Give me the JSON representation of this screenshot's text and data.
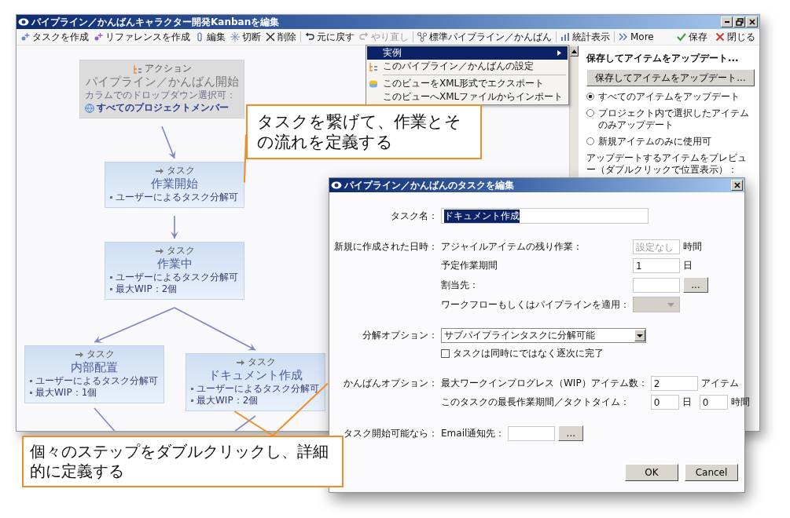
{
  "window": {
    "title": "パイプライン／かんばんキャラクター開発Kanbanを編集"
  },
  "toolbar": {
    "groups": [
      [
        {
          "label": "タスクを作成",
          "disabled": false
        },
        {
          "label": "リファレンスを作成",
          "disabled": false
        },
        {
          "label": "編集",
          "disabled": false
        },
        {
          "label": "切断",
          "disabled": false
        },
        {
          "label": "削除",
          "disabled": false
        }
      ],
      [
        {
          "label": "元に戻す",
          "disabled": false
        },
        {
          "label": "やり直し",
          "disabled": true
        }
      ],
      [
        {
          "label": "標準パイプライン／かんばん",
          "disabled": false
        }
      ],
      [
        {
          "label": "統計表示",
          "disabled": false
        }
      ],
      [
        {
          "label": "More",
          "disabled": false
        }
      ]
    ],
    "actions": [
      {
        "label": "保存"
      },
      {
        "label": "閉じる"
      }
    ]
  },
  "menu": {
    "groups": [
      [
        {
          "label": "実例",
          "selected": true,
          "submenu": true
        },
        {
          "label": "このパイプライン／かんばんの設定",
          "selected": false,
          "submenu": false
        }
      ],
      [
        {
          "label": "このビューをXML形式でエクスポート",
          "selected": false,
          "submenu": false
        },
        {
          "label": "このビューへXMLファイルからインポート",
          "selected": false,
          "submenu": false
        }
      ]
    ]
  },
  "canvas": {
    "nodes": [
      {
        "kind": "action",
        "type_label": "アクション",
        "title": "パイプライン／かんばん開始",
        "note": "カラムでのドロップダウン選択可：",
        "member": "すべてのプロジェクトメンバー",
        "continues_below": false
      },
      {
        "kind": "task",
        "type_label": "タスク",
        "title": "作業開始",
        "bullets": [
          "ユーザーによるタスク分解可"
        ],
        "continues_below": false
      },
      {
        "kind": "task",
        "type_label": "タスク",
        "title": "作業中",
        "bullets": [
          "ユーザーによるタスク分解可",
          "最大WIP：2個"
        ],
        "continues_below": false
      },
      {
        "kind": "task",
        "type_label": "タスク",
        "title": "内部配置",
        "bullets": [
          "ユーザーによるタスク分解可",
          "最大WIP：1個"
        ],
        "continues_below": true
      },
      {
        "kind": "task",
        "type_label": "タスク",
        "title": "ドキュメント作成",
        "bullets": [
          "ユーザーによるタスク分解可",
          "最大WIP：2個"
        ],
        "continues_below": true
      }
    ]
  },
  "side_panel": {
    "heading": "保存してアイテムをアップデート...",
    "button": "保存してアイテムをアップデート...",
    "radios": [
      {
        "label": "すべてのアイテムをアップデート",
        "selected": true
      },
      {
        "label": "プロジェクト内で選択したアイテムのみアップデート",
        "selected": false
      },
      {
        "label": "新規アイテムのみに使用可",
        "selected": false
      }
    ],
    "preview_label": "アップデートするアイテムをプレビュー（ダブルクリックで位置表示）："
  },
  "dialog": {
    "title": "パイプライン／かんばんのタスクを編集",
    "groups": [
      {
        "label": "タスク名：",
        "rows": [
          {
            "kind": "name",
            "value": "ドキュメント作成",
            "value_selected": true
          }
        ]
      },
      {
        "label": "新規に作成された日時：",
        "rows": [
          {
            "kind": "field",
            "label": "アジャイルアイテムの残り作業：",
            "placeholder": "設定なし",
            "unit": "時間"
          },
          {
            "kind": "field",
            "label": "予定作業期間",
            "value": "1",
            "unit": "日"
          },
          {
            "kind": "picker",
            "label": "割当先：",
            "button": "..."
          },
          {
            "kind": "combo",
            "label": "ワークフローもしくはパイプラインを適用：",
            "disabled": true
          }
        ]
      },
      {
        "label": "分解オプション：",
        "rows": [
          {
            "kind": "select",
            "value": "サブパイプラインタスクに分解可能"
          },
          {
            "kind": "checkbox",
            "label": "タスクは同時にではなく逐次に完了",
            "checked": false
          }
        ]
      },
      {
        "label": "かんばんオプション：",
        "rows": [
          {
            "kind": "field",
            "label": "最大ワークインプログレス（WIP）アイテム数：",
            "value": "2",
            "unit": "アイテム"
          },
          {
            "kind": "duration",
            "label": "このタスクの最長作業期間／タクトタイム：",
            "fields": [
              {
                "value": "0",
                "unit": "日"
              },
              {
                "value": "0",
                "unit": "時間"
              }
            ]
          }
        ]
      },
      {
        "label": "タスク開始可能なら：",
        "rows": [
          {
            "kind": "picker",
            "label": "Email通知先：",
            "button": "..."
          }
        ]
      }
    ],
    "buttons": [
      {
        "label": "OK"
      },
      {
        "label": "Cancel"
      }
    ]
  },
  "callouts": [
    {
      "text": "タスクを繋げて、作業とその流れを定義する"
    },
    {
      "text": "個々のステップをダブルクリックし、詳細的に定義する"
    }
  ]
}
